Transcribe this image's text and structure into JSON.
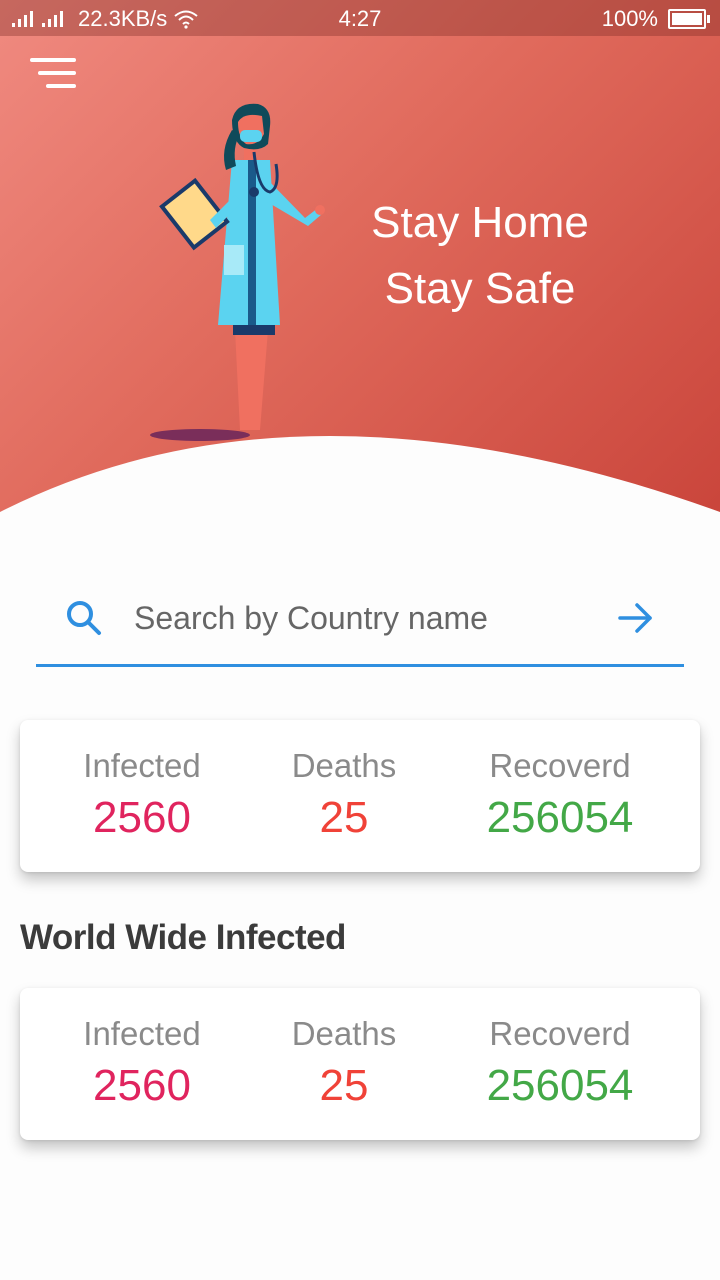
{
  "status_bar": {
    "network_speed": "22.3KB/s",
    "time": "4:27",
    "battery": "100%"
  },
  "hero": {
    "line1": "Stay Home",
    "line2": "Stay Safe"
  },
  "search": {
    "placeholder": "Search by Country name",
    "value": ""
  },
  "country_stats": {
    "infected_label": "Infected",
    "infected_value": "2560",
    "deaths_label": "Deaths",
    "deaths_value": "25",
    "recovered_label": "Recoverd",
    "recovered_value": "256054"
  },
  "world_section": {
    "title": "World Wide Infected",
    "infected_label": "Infected",
    "infected_value": "2560",
    "deaths_label": "Deaths",
    "deaths_value": "25",
    "recovered_label": "Recoverd",
    "recovered_value": "256054"
  },
  "colors": {
    "infected": "#e0245e",
    "deaths": "#f04238",
    "recovered": "#43a847",
    "accent": "#2f8fe0",
    "hero_start": "#f08a80",
    "hero_end": "#c9443a"
  },
  "icons": [
    "signal-icon",
    "wifi-icon",
    "battery-icon",
    "menu-icon",
    "search-icon",
    "arrow-right-icon",
    "doctor-illustration"
  ]
}
